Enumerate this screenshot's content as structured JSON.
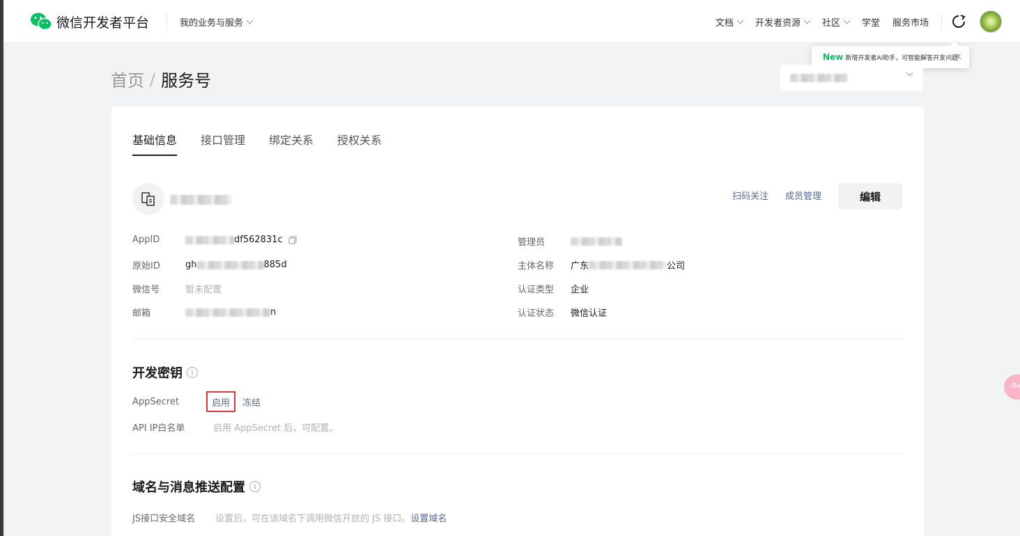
{
  "topnav": {
    "logo_text": "微信开发者平台",
    "biz_menu": "我的业务与服务",
    "items": [
      "文档",
      "开发者资源",
      "社区",
      "学堂",
      "服务市场"
    ]
  },
  "tooltip": {
    "badge": "New",
    "text": "新增开发者AI助手，可智能解答开发问题"
  },
  "breadcrumb": {
    "home": "首页",
    "sep": "/",
    "current": "服务号"
  },
  "tabs": [
    "基础信息",
    "接口管理",
    "绑定关系",
    "授权关系"
  ],
  "account": {
    "scan_follow": "扫码关注",
    "member_manage": "成员管理",
    "edit": "编辑"
  },
  "basic_info": {
    "appid_label": "AppID",
    "appid_value": "df562831c",
    "original_id_label": "原始ID",
    "original_id_prefix": "gh",
    "original_id_suffix": "885d",
    "wechat_id_label": "微信号",
    "wechat_id_value": "暂未配置",
    "email_label": "邮箱",
    "email_suffix": "n",
    "admin_label": "管理员",
    "entity_label": "主体名称",
    "entity_prefix": "广东",
    "entity_suffix": "公司",
    "cert_type_label": "认证类型",
    "cert_type_value": "企业",
    "cert_status_label": "认证状态",
    "cert_status_value": "微信认证"
  },
  "dev_key": {
    "title": "开发密钥",
    "appsecret_label": "AppSecret",
    "enable": "启用",
    "freeze": "冻结",
    "ip_whitelist_label": "API IP白名单",
    "ip_whitelist_hint": "启用 AppSecret 后，可配置。"
  },
  "domain_config": {
    "title": "域名与消息推送配置",
    "js_domain_label": "JS接口安全域名",
    "js_domain_hint": "设置后，可在该域名下调用微信开放的 JS 接口。",
    "js_domain_link": "设置域名"
  },
  "side_float": "中A",
  "colors": {
    "brand_green": "#07c160",
    "link_blue": "#576b95",
    "highlight_red": "#d9363e"
  }
}
